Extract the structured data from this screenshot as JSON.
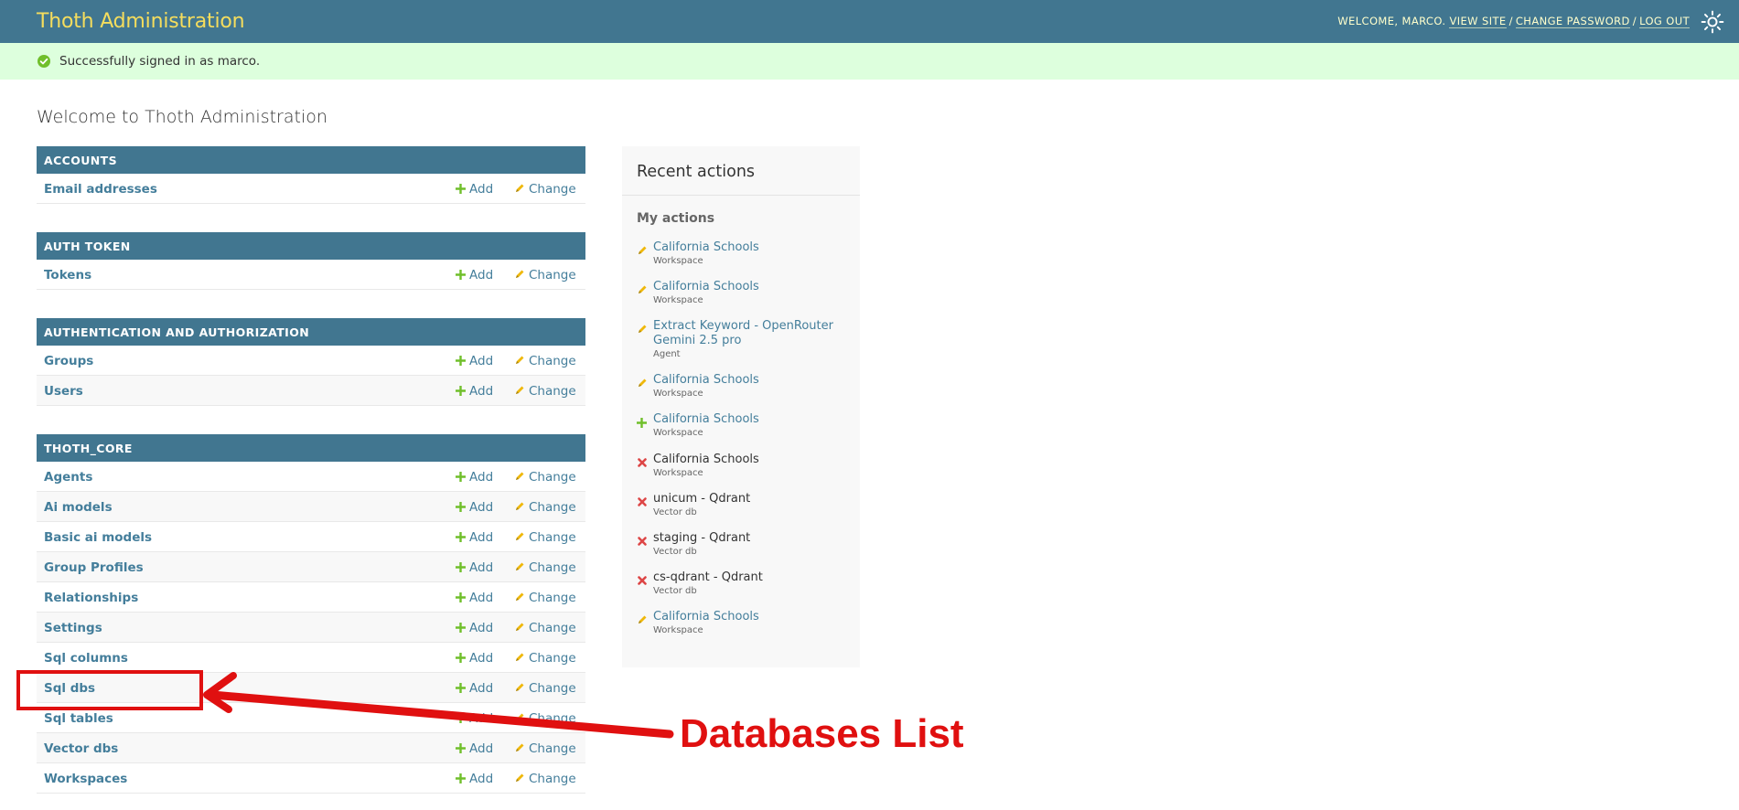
{
  "header": {
    "brand": "Thoth Administration",
    "welcome": "WELCOME, MARCO.",
    "view_site": "VIEW SITE",
    "change_password": "CHANGE PASSWORD",
    "log_out": "LOG OUT",
    "separator": "/",
    "theme_icon": "sun-icon"
  },
  "message": {
    "icon": "check-circle-icon",
    "text": "Successfully signed in as marco."
  },
  "page_title": "Welcome to Thoth Administration",
  "link_labels": {
    "add": "Add",
    "change": "Change"
  },
  "apps": [
    {
      "caption": "ACCOUNTS",
      "models": [
        "Email addresses"
      ]
    },
    {
      "caption": "AUTH TOKEN",
      "models": [
        "Tokens"
      ]
    },
    {
      "caption": "AUTHENTICATION AND AUTHORIZATION",
      "models": [
        "Groups",
        "Users"
      ]
    },
    {
      "caption": "THOTH_CORE",
      "models": [
        "Agents",
        "Ai models",
        "Basic ai models",
        "Group Profiles",
        "Relationships",
        "Settings",
        "Sql columns",
        "Sql dbs",
        "Sql tables",
        "Vector dbs",
        "Workspaces"
      ]
    }
  ],
  "recent_actions": {
    "title": "Recent actions",
    "subtitle": "My actions",
    "items": [
      {
        "kind": "change",
        "title": "California Schools",
        "type": "Workspace"
      },
      {
        "kind": "change",
        "title": "California Schools",
        "type": "Workspace"
      },
      {
        "kind": "change",
        "title": "Extract Keyword - OpenRouter Gemini 2.5 pro",
        "type": "Agent"
      },
      {
        "kind": "change",
        "title": "California Schools",
        "type": "Workspace"
      },
      {
        "kind": "add",
        "title": "California Schools",
        "type": "Workspace"
      },
      {
        "kind": "delete",
        "title": "California Schools",
        "type": "Workspace"
      },
      {
        "kind": "delete",
        "title": "unicum - Qdrant",
        "type": "Vector db"
      },
      {
        "kind": "delete",
        "title": "staging - Qdrant",
        "type": "Vector db"
      },
      {
        "kind": "delete",
        "title": "cs-qdrant - Qdrant",
        "type": "Vector db"
      },
      {
        "kind": "change",
        "title": "California Schools",
        "type": "Workspace"
      }
    ]
  },
  "annotation": {
    "label": "Databases List",
    "color": "#e01010"
  },
  "colors": {
    "header_bg": "#417690",
    "brand": "#f5dd5d",
    "link": "#447e9b",
    "success_bg": "#ddffdd",
    "add_icon": "#70bf2b",
    "change_icon": "#efb80b",
    "delete_icon": "#dd4646"
  }
}
